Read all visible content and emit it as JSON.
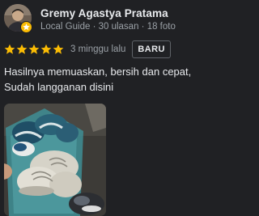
{
  "reviewer": {
    "name": "Gremy Agastya Pratama",
    "meta": "Local Guide · 30 ulasan · 18 foto",
    "avatar_icon": "avatar-photo",
    "badge_icon": "local-guide-star-icon"
  },
  "review": {
    "rating": 5,
    "rating_max": 5,
    "time": "3 minggu lalu",
    "new_badge": "BARU",
    "text_lines": [
      "Hasilnya memuaskan, bersih dan cepat,",
      "Sudah langganan disini"
    ],
    "photo_icon": "review-photo-shoes"
  },
  "colors": {
    "background": "#202124",
    "star": "#fbbc04",
    "secondary_text": "#9aa0a6"
  }
}
